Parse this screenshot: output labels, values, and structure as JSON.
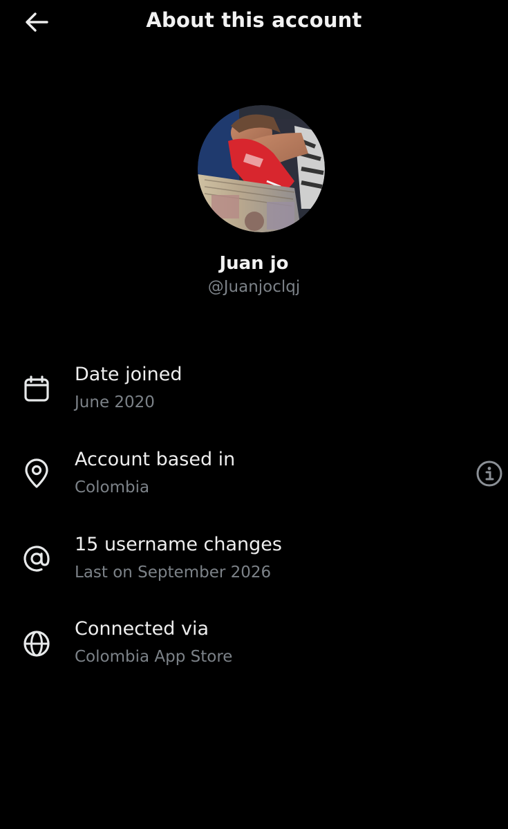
{
  "header": {
    "title": "About this account",
    "back_icon": "arrow-left-icon"
  },
  "profile": {
    "name": "Juan jo",
    "handle": "@Juanjoclqj",
    "avatar_icon": "profile-photo"
  },
  "details": [
    {
      "icon": "calendar-icon",
      "title": "Date joined",
      "value": "June 2020"
    },
    {
      "icon": "location-pin-icon",
      "title": "Account based in",
      "value": "Colombia",
      "action_icon": "info-icon"
    },
    {
      "icon": "at-sign-icon",
      "title": "15 username changes",
      "value": "Last on September 2026"
    },
    {
      "icon": "globe-icon",
      "title": "Connected via",
      "value": "Colombia App Store"
    }
  ],
  "colors": {
    "background": "#000000",
    "primary_text": "#e7e9ea",
    "secondary_text": "#7c8288"
  }
}
